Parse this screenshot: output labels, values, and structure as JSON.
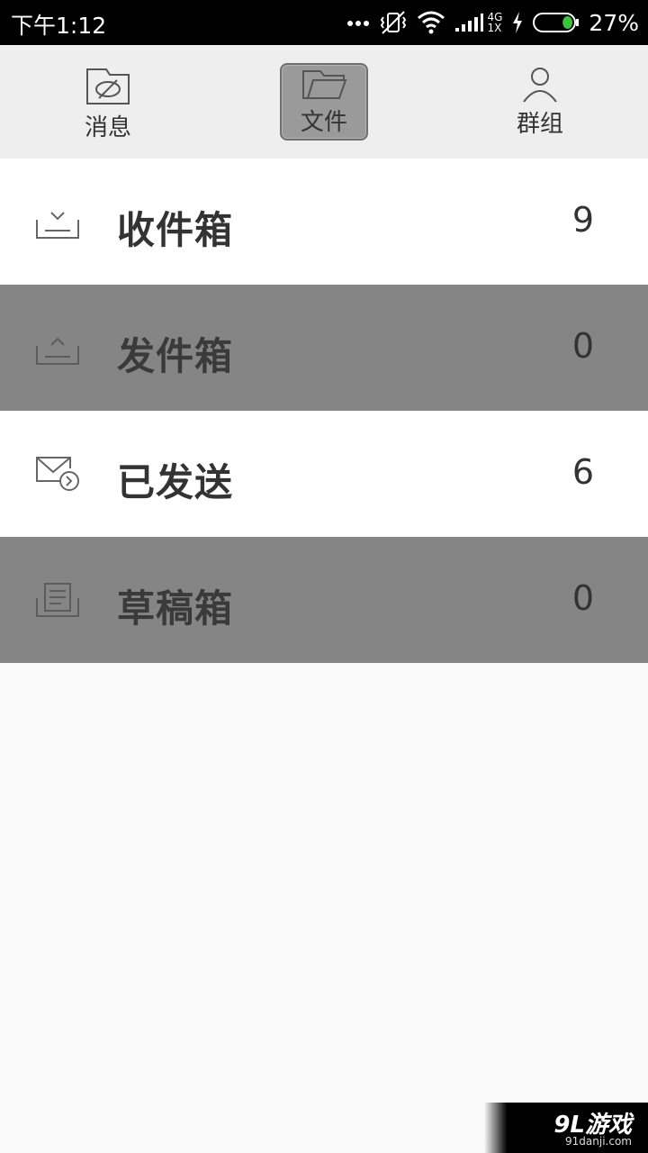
{
  "status_bar": {
    "time": "下午1:12",
    "network_top": "4G",
    "network_bottom": "1X",
    "battery_percent": "27%",
    "battery_level": 0.27,
    "icons": [
      "more-dots-icon",
      "vibrate-off-icon",
      "wifi-icon",
      "signal-icon",
      "charging-icon",
      "battery-icon"
    ]
  },
  "tabs": [
    {
      "label": "消息",
      "icon": "message-icon",
      "selected": false
    },
    {
      "label": "文件",
      "icon": "folder-icon",
      "selected": true
    },
    {
      "label": "群组",
      "icon": "person-icon",
      "selected": false
    }
  ],
  "list": [
    {
      "label": "收件箱",
      "count": "9",
      "icon": "inbox-icon"
    },
    {
      "label": "发件箱",
      "count": "0",
      "icon": "outbox-icon"
    },
    {
      "label": "已发送",
      "count": "6",
      "icon": "sent-icon"
    },
    {
      "label": "草稿箱",
      "count": "0",
      "icon": "draft-icon"
    }
  ],
  "watermark": {
    "brand": "9L游戏",
    "url": "91danji.com"
  },
  "colors": {
    "accent_battery": "#3cc43c",
    "row_dark": "#858585",
    "row_light": "#ffffff"
  }
}
